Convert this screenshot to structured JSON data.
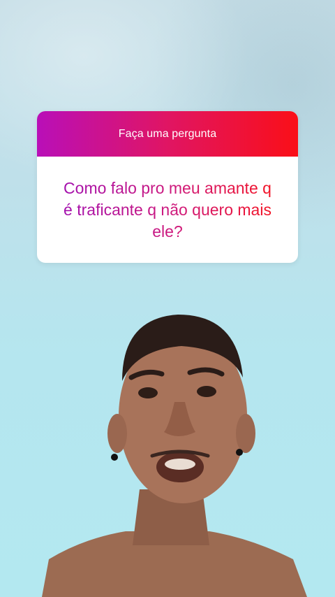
{
  "question_sticker": {
    "header_label": "Faça uma pergunta",
    "question_text": "Como falo pro meu amante q é traficante q não quero mais ele?"
  },
  "colors": {
    "gradient_start": "#b90fb8",
    "gradient_mid": "#e01563",
    "gradient_end": "#fa0f18",
    "background_wall": "#b5e6ef"
  }
}
